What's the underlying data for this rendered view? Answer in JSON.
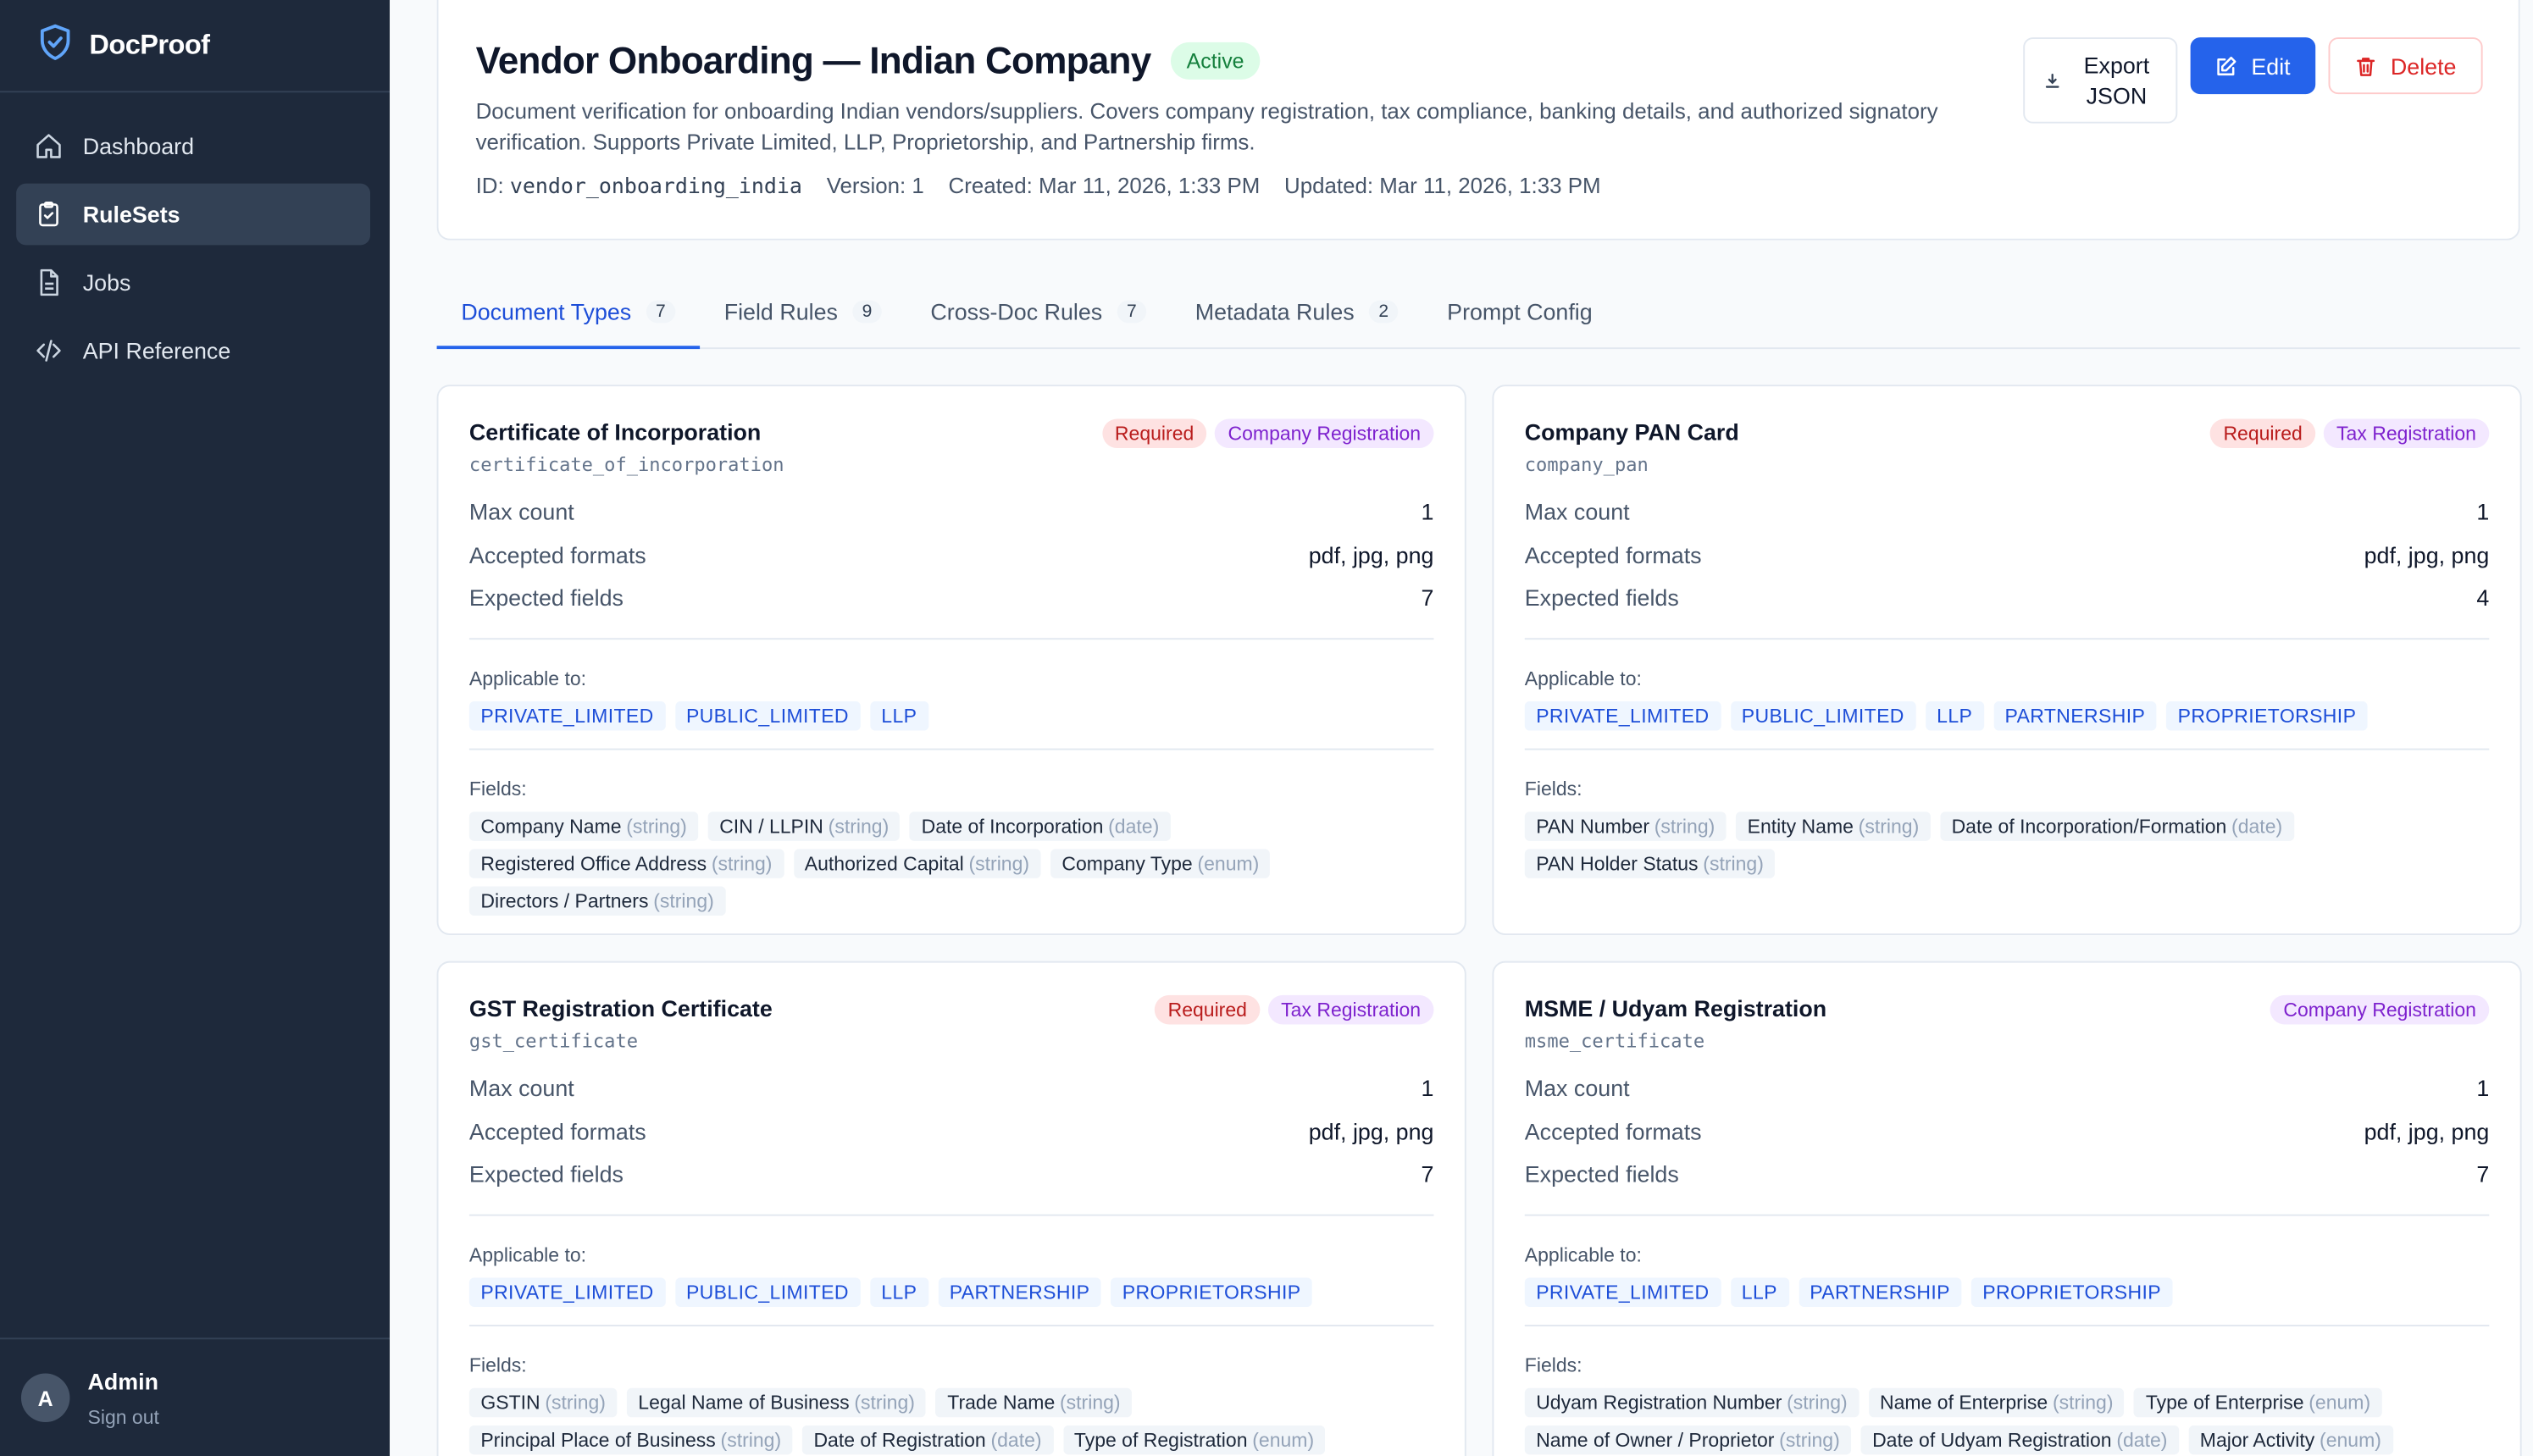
{
  "brand": {
    "name": "DocProof"
  },
  "nav": [
    {
      "label": "Dashboard",
      "icon": "home-icon"
    },
    {
      "label": "RuleSets",
      "icon": "clipboard-check-icon",
      "active": true
    },
    {
      "label": "Jobs",
      "icon": "file-icon"
    },
    {
      "label": "API Reference",
      "icon": "code-icon"
    }
  ],
  "user": {
    "initial": "A",
    "name": "Admin",
    "sign_out": "Sign out"
  },
  "header": {
    "title": "Vendor Onboarding — Indian Company",
    "status": "Active",
    "description": "Document verification for onboarding Indian vendors/suppliers. Covers company registration, tax compliance, banking details, and authorized signatory verification. Supports Private Limited, LLP, Proprietorship, and Partnership firms.",
    "id_label": "ID:",
    "id_value": "vendor_onboarding_india",
    "version": "Version: 1",
    "created": "Created: Mar 11, 2026, 1:33 PM",
    "updated": "Updated: Mar 11, 2026, 1:33 PM",
    "actions": {
      "export": "Export JSON",
      "edit": "Edit",
      "delete": "Delete"
    }
  },
  "tabs": [
    {
      "label": "Document Types",
      "count": "7",
      "active": true
    },
    {
      "label": "Field Rules",
      "count": "9"
    },
    {
      "label": "Cross-Doc Rules",
      "count": "7"
    },
    {
      "label": "Metadata Rules",
      "count": "2"
    },
    {
      "label": "Prompt Config",
      "count": ""
    }
  ],
  "labels": {
    "max_count": "Max count",
    "accepted_formats": "Accepted formats",
    "expected_fields": "Expected fields",
    "applicable_to": "Applicable to:",
    "fields": "Fields:"
  },
  "cards": [
    {
      "title": "Certificate of Incorporation",
      "code": "certificate_of_incorporation",
      "required": "Required",
      "category": "Company Registration",
      "max_count": "1",
      "formats": "pdf, jpg, png",
      "expected_fields": "7",
      "applicable": [
        "PRIVATE_LIMITED",
        "PUBLIC_LIMITED",
        "LLP"
      ],
      "fields": [
        {
          "name": "Company Name",
          "type": "(string)"
        },
        {
          "name": "CIN / LLPIN",
          "type": "(string)"
        },
        {
          "name": "Date of Incorporation",
          "type": "(date)"
        },
        {
          "name": "Registered Office Address",
          "type": "(string)"
        },
        {
          "name": "Authorized Capital",
          "type": "(string)"
        },
        {
          "name": "Company Type",
          "type": "(enum)"
        },
        {
          "name": "Directors / Partners",
          "type": "(string)"
        }
      ]
    },
    {
      "title": "Company PAN Card",
      "code": "company_pan",
      "required": "Required",
      "category": "Tax Registration",
      "max_count": "1",
      "formats": "pdf, jpg, png",
      "expected_fields": "4",
      "applicable": [
        "PRIVATE_LIMITED",
        "PUBLIC_LIMITED",
        "LLP",
        "PARTNERSHIP",
        "PROPRIETORSHIP"
      ],
      "fields": [
        {
          "name": "PAN Number",
          "type": "(string)"
        },
        {
          "name": "Entity Name",
          "type": "(string)"
        },
        {
          "name": "Date of Incorporation/Formation",
          "type": "(date)"
        },
        {
          "name": "PAN Holder Status",
          "type": "(string)"
        }
      ]
    },
    {
      "title": "GST Registration Certificate",
      "code": "gst_certificate",
      "required": "Required",
      "category": "Tax Registration",
      "max_count": "1",
      "formats": "pdf, jpg, png",
      "expected_fields": "7",
      "applicable": [
        "PRIVATE_LIMITED",
        "PUBLIC_LIMITED",
        "LLP",
        "PARTNERSHIP",
        "PROPRIETORSHIP"
      ],
      "fields": [
        {
          "name": "GSTIN",
          "type": "(string)"
        },
        {
          "name": "Legal Name of Business",
          "type": "(string)"
        },
        {
          "name": "Trade Name",
          "type": "(string)"
        },
        {
          "name": "Principal Place of Business",
          "type": "(string)"
        },
        {
          "name": "Date of Registration",
          "type": "(date)"
        },
        {
          "name": "Type of Registration",
          "type": "(enum)"
        }
      ]
    },
    {
      "title": "MSME / Udyam Registration",
      "code": "msme_certificate",
      "required": "",
      "category": "Company Registration",
      "max_count": "1",
      "formats": "pdf, jpg, png",
      "expected_fields": "7",
      "applicable": [
        "PRIVATE_LIMITED",
        "LLP",
        "PARTNERSHIP",
        "PROPRIETORSHIP"
      ],
      "fields": [
        {
          "name": "Udyam Registration Number",
          "type": "(string)"
        },
        {
          "name": "Name of Enterprise",
          "type": "(string)"
        },
        {
          "name": "Type of Enterprise",
          "type": "(enum)"
        },
        {
          "name": "Name of Owner / Proprietor",
          "type": "(string)"
        },
        {
          "name": "Date of Udyam Registration",
          "type": "(date)"
        },
        {
          "name": "Major Activity",
          "type": "(enum)"
        }
      ]
    }
  ]
}
